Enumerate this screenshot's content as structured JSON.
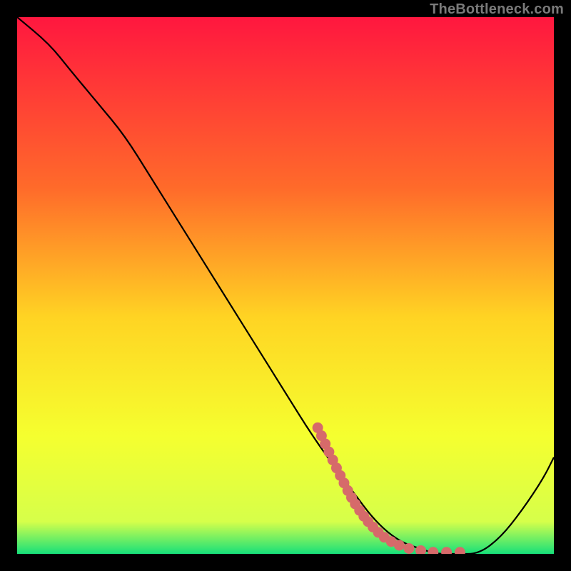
{
  "watermark": "TheBottleneck.com",
  "colors": {
    "bg": "#000000",
    "grad_top": "#ff173f",
    "grad_25": "#ff6b2a",
    "grad_50": "#ffd423",
    "grad_75": "#f5ff2f",
    "grad_bottom": "#17e07a",
    "curve": "#000000",
    "dots": "#d66a6a"
  },
  "chart_data": {
    "type": "line",
    "title": "",
    "xlabel": "",
    "ylabel": "",
    "xlim": [
      0,
      100
    ],
    "ylim": [
      0,
      100
    ],
    "series": [
      {
        "name": "bottleneck-curve",
        "x": [
          0,
          6,
          10,
          15,
          20,
          25,
          30,
          35,
          40,
          45,
          50,
          55,
          60,
          63,
          66,
          69,
          72,
          75,
          78,
          82,
          86,
          90,
          94,
          98,
          100
        ],
        "y": [
          100,
          95,
          90,
          84,
          78,
          70,
          62,
          54,
          46,
          38,
          30,
          22,
          15,
          11,
          7,
          4,
          2,
          1,
          0,
          0,
          0,
          3,
          8,
          14,
          18
        ]
      }
    ],
    "highlight_dots": {
      "name": "salmon-dot-cluster",
      "points": [
        {
          "x": 56.0,
          "y": 23.5
        },
        {
          "x": 56.7,
          "y": 22.0
        },
        {
          "x": 57.4,
          "y": 20.5
        },
        {
          "x": 58.1,
          "y": 19.0
        },
        {
          "x": 58.8,
          "y": 17.5
        },
        {
          "x": 59.5,
          "y": 16.0
        },
        {
          "x": 60.2,
          "y": 14.6
        },
        {
          "x": 60.9,
          "y": 13.2
        },
        {
          "x": 61.6,
          "y": 11.8
        },
        {
          "x": 62.3,
          "y": 10.5
        },
        {
          "x": 63.0,
          "y": 9.3
        },
        {
          "x": 63.8,
          "y": 8.1
        },
        {
          "x": 64.6,
          "y": 7.0
        },
        {
          "x": 65.4,
          "y": 6.0
        },
        {
          "x": 66.3,
          "y": 5.0
        },
        {
          "x": 67.3,
          "y": 4.0
        },
        {
          "x": 68.4,
          "y": 3.1
        },
        {
          "x": 69.7,
          "y": 2.3
        },
        {
          "x": 71.2,
          "y": 1.6
        },
        {
          "x": 73.0,
          "y": 1.0
        },
        {
          "x": 75.2,
          "y": 0.6
        },
        {
          "x": 77.5,
          "y": 0.3
        },
        {
          "x": 80.0,
          "y": 0.3
        },
        {
          "x": 82.5,
          "y": 0.3
        }
      ]
    }
  }
}
